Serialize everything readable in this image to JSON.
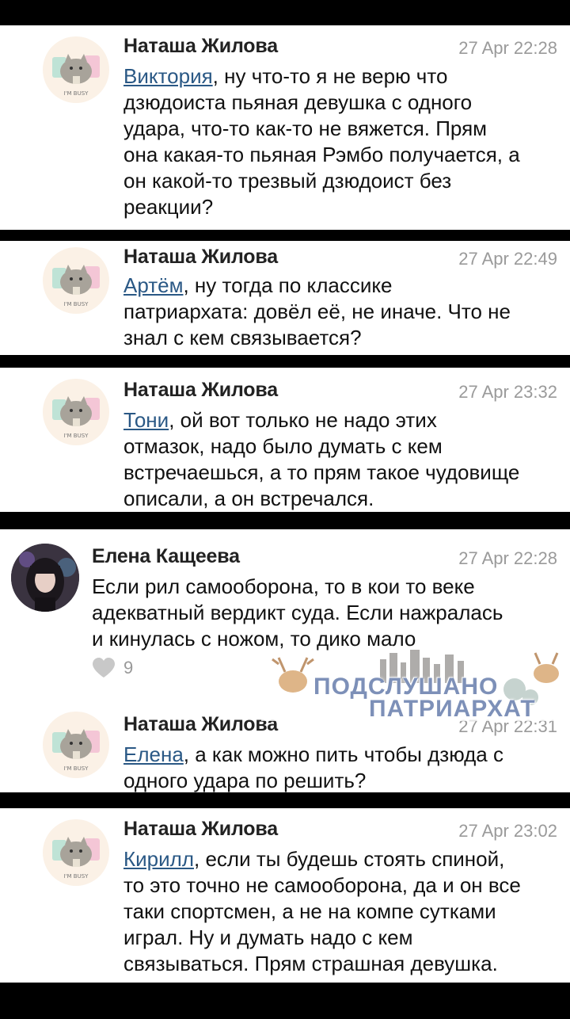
{
  "comments": [
    {
      "author": "Наташа Жилова",
      "time": "27 Apr 22:28",
      "mention": "Виктория",
      "text": ", ну что-то я не верю что\nдзюдоиста пьяная девушка с одного\nудара, что-то как-то не вяжется. Прям\nона какая-то пьяная Рэмбо получается, а\nон какой-то трезвый дзюдоист без\nреакции?",
      "avatar_caption": "I'M BUSY"
    },
    {
      "author": "Наташа Жилова",
      "time": "27 Apr 22:49",
      "mention": "Артём",
      "text": ", ну тогда по классике\nпатриархата: довёл её, не иначе. Что не\nзнал с кем связывается?",
      "avatar_caption": "I'M BUSY"
    },
    {
      "author": "Наташа Жилова",
      "time": "27 Apr 23:32",
      "mention": "Тони",
      "text": ", ой вот только не надо этих\nотмазок, надо было думать с кем\nвстречаешься, а то прям такое чудовище\nописали, а он встречался.",
      "avatar_caption": "I'M BUSY"
    },
    {
      "author": "Елена Кащеева",
      "time": "27 Apr 22:28",
      "text": "Если рил самооборона, то в кои то веке\nадекватный вердикт суда. Если нажралась\nи кинулась с ножом, то дико мало",
      "likes": "9"
    },
    {
      "author": "Наташа Жилова",
      "time": "27 Apr 22:31",
      "mention": "Елена",
      "text": ", а как можно пить чтобы дзюда с\nодного удара по решить?",
      "avatar_caption": "I'M BUSY"
    },
    {
      "author": "Наташа Жилова",
      "time": "27 Apr 23:02",
      "mention": "Кирилл",
      "text": ", если ты будешь стоять спиной,\nто это точно не самооборона, да и он все\nтаки спортсмен, а не на компе сутками\nиграл. Ну и думать надо с кем\nсвязываться. Прям страшная девушка.",
      "avatar_caption": "I'M BUSY"
    }
  ],
  "watermark": {
    "line1": "ПОДСЛУШАНО",
    "line2": "ПАТРИАРХАТ"
  },
  "colors": {
    "mention": "#2a5885",
    "timestamp": "#9a9a9a",
    "separator": "#000000"
  }
}
